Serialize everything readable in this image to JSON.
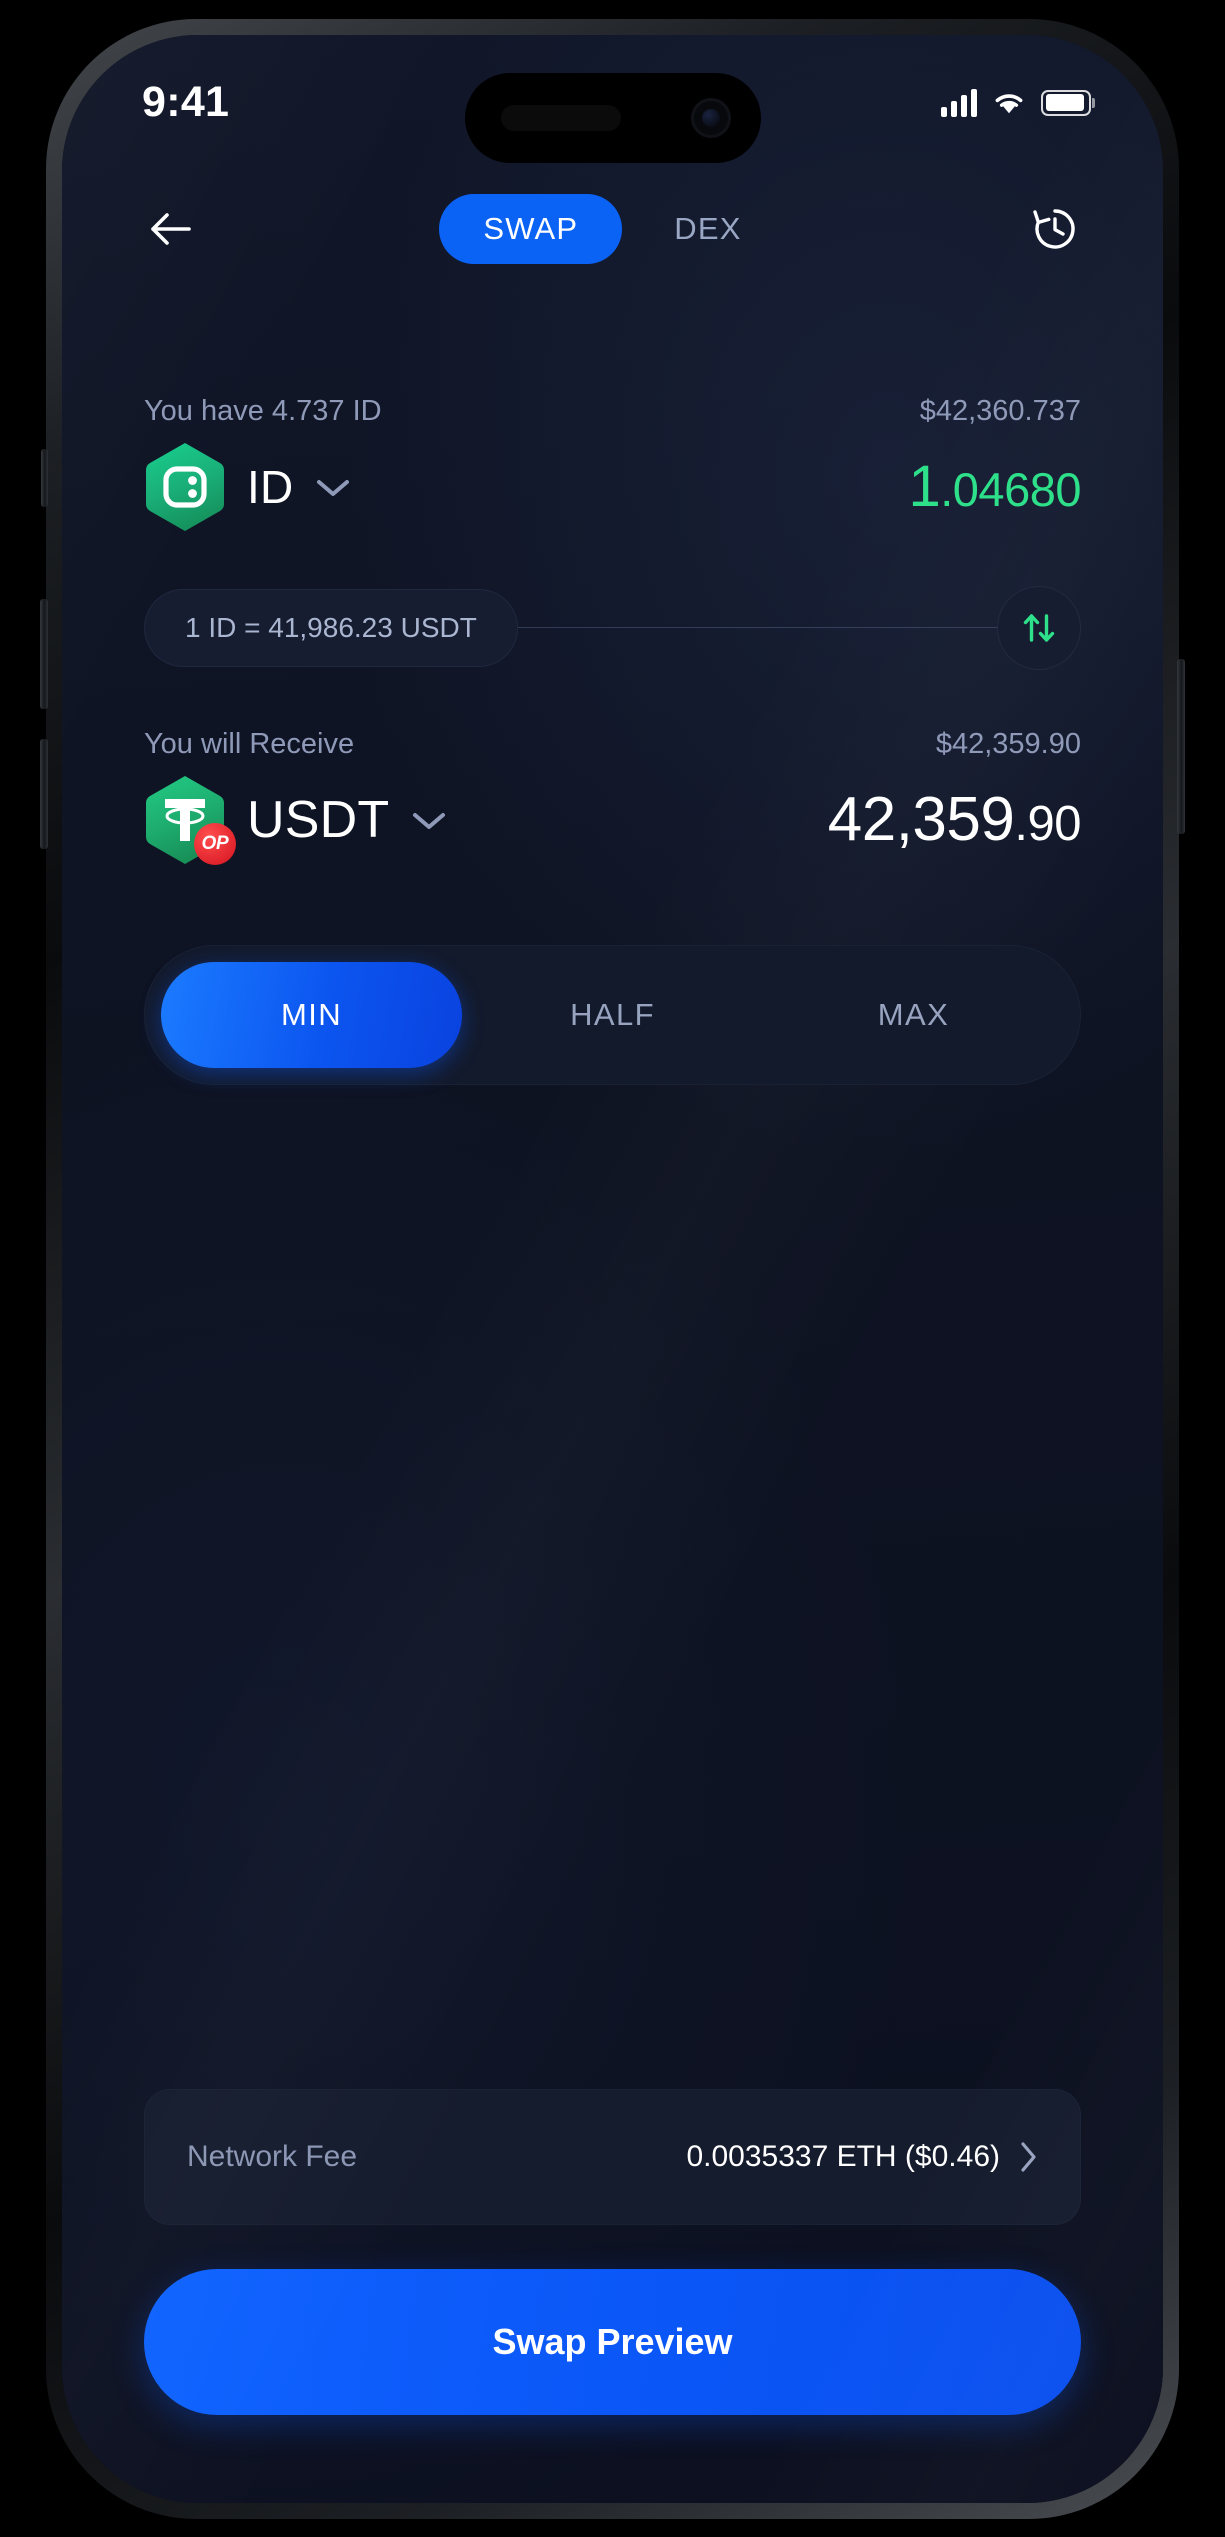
{
  "status_bar": {
    "time": "9:41",
    "signal_icon": "cellular-signal-icon",
    "wifi_icon": "wifi-icon",
    "battery_icon": "battery-icon"
  },
  "nav": {
    "back_icon": "back-arrow-icon",
    "history_icon": "history-clock-icon",
    "tabs": [
      {
        "label": "SWAP",
        "active": true
      },
      {
        "label": "DEX",
        "active": false
      }
    ]
  },
  "from_section": {
    "balance_label": "You have 4.737 ID",
    "fiat_value": "$42,360.737",
    "token_symbol": "ID",
    "token_icon": "id-token-icon",
    "chevron_icon": "chevron-down-icon",
    "amount_int": "1",
    "amount_dec": ".04680",
    "amount_color": "#2ee08a"
  },
  "rate_strip": {
    "rate_text": "1 ID = 41,986.23 USDT",
    "swap_direction_icon": "swap-vertical-arrows-icon",
    "swap_direction_color": "#2ee08a"
  },
  "to_section": {
    "receive_label": "You will Receive",
    "fiat_value": "$42,359.90",
    "token_symbol": "USDT",
    "token_icon": "usdt-token-icon",
    "network_badge": "OP",
    "network_badge_icon": "optimism-network-badge",
    "chevron_icon": "chevron-down-icon",
    "amount_int": "42,359",
    "amount_dec": ".90"
  },
  "amount_selector": {
    "options": [
      {
        "label": "MIN",
        "active": true
      },
      {
        "label": "HALF",
        "active": false
      },
      {
        "label": "MAX",
        "active": false
      }
    ]
  },
  "network_fee": {
    "label": "Network Fee",
    "value": "0.0035337 ETH ($0.46)",
    "chevron_icon": "chevron-right-icon"
  },
  "primary_action": {
    "label": "Swap Preview"
  },
  "theme": {
    "accent_blue": "#0b63f6",
    "accent_green": "#2ee08a",
    "background": "#0e1322",
    "card": "#151c2e"
  }
}
